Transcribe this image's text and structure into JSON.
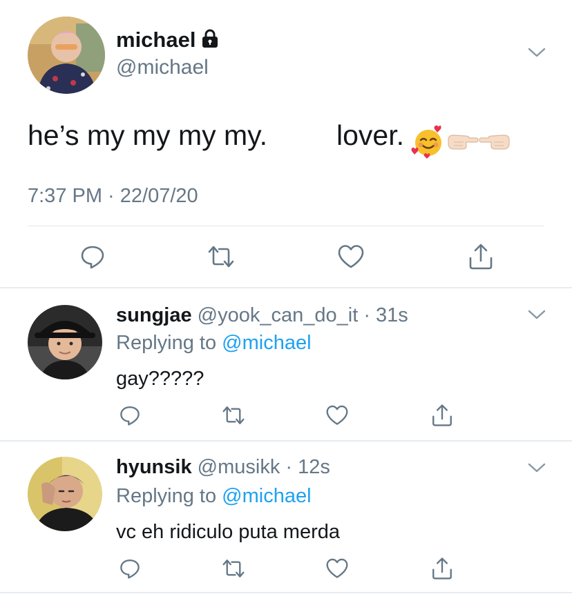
{
  "main_tweet": {
    "display_name": "michael",
    "handle": "@michael",
    "text_part1": "he’s my my my my.",
    "text_part2": "lover.",
    "emojis": [
      "smiling-face-with-hearts",
      "backhand-index-pointing-right",
      "backhand-index-pointing-left"
    ],
    "timestamp": "7:37 PM · 22/07/20",
    "lock_icon": "lock-icon",
    "actions": [
      "reply-icon",
      "retweet-icon",
      "like-icon",
      "share-icon"
    ]
  },
  "replies": [
    {
      "display_name": "sungjae",
      "handle": "@yook_can_do_it",
      "time": "· 31s",
      "replying_label": "Replying to",
      "replying_to": "@michael",
      "text": "gay?????"
    },
    {
      "display_name": "hyunsik",
      "handle": "@musikk",
      "time": "· 12s",
      "replying_label": "Replying to",
      "replying_to": "@michael",
      "text": "vc eh ridiculo puta merda"
    }
  ],
  "colors": {
    "text": "#14171a",
    "secondary": "#657786",
    "link": "#1da1f2",
    "divider": "#e6ecf0"
  }
}
